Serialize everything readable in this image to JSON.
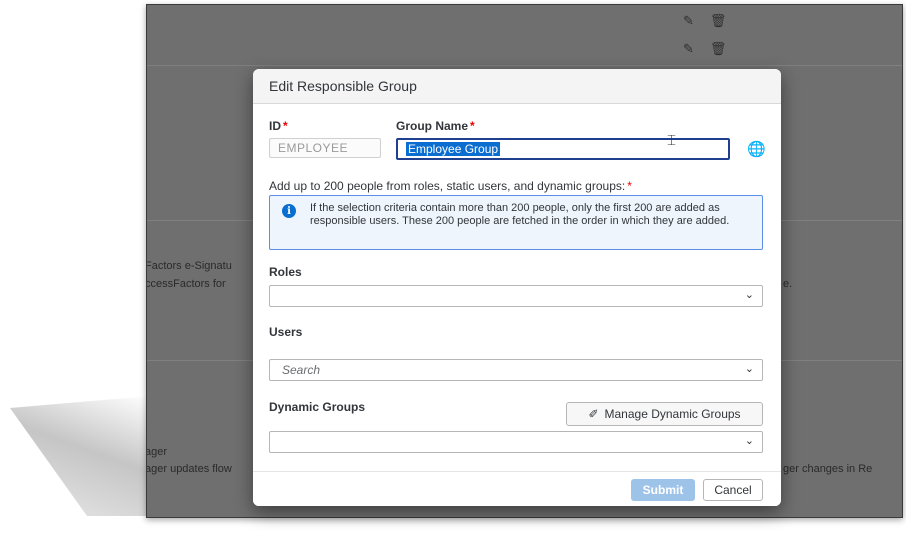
{
  "background": {
    "left_text_1": "Factors e-Signatu",
    "left_text_2": "ccessFactors for",
    "right_text_1": "e.",
    "left_text_3": "ager",
    "left_text_4": "ager updates flow",
    "right_text_2": "ger changes in Re",
    "row_icons": [
      "pencil-icon",
      "trash-icon"
    ]
  },
  "dialog": {
    "title": "Edit Responsible Group",
    "id_label": "ID",
    "id_value": "EMPLOYEE",
    "group_name_label": "Group Name",
    "group_name_value": "Employee Group",
    "required_marker": "*",
    "add_people_hint": "Add up to 200 people from roles, static users, and dynamic groups:",
    "info_message": "If the selection criteria contain more than 200 people, only the first 200 are added as responsible users. These 200 people are fetched in the order in which they are added.",
    "roles_label": "Roles",
    "roles_value": "",
    "users_label": "Users",
    "users_placeholder": "Search",
    "dynamic_groups_label": "Dynamic Groups",
    "manage_dynamic_groups_label": "Manage Dynamic Groups",
    "dynamic_groups_value": "",
    "submit_label": "Submit",
    "cancel_label": "Cancel"
  },
  "colors": {
    "accent": "#0a6ed1",
    "required": "#e00000",
    "submit_disabled": "#9ec3e8"
  }
}
